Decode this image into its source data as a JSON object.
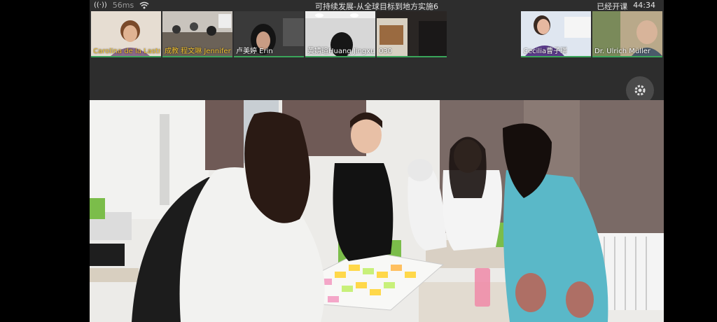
{
  "status_bar": {
    "network_latency": "56ms",
    "meeting_title": "可持续发展-从全球目标到地方实施6",
    "class_status": "已经开课",
    "time": "44:34"
  },
  "participants": [
    {
      "name": "Carolina de la Lastra",
      "name_color": "#f0c030"
    },
    {
      "name": "成教 程文琳 Jennifer",
      "name_color": "#f0c030"
    },
    {
      "name": "卢美婷 Erin",
      "name_color": "#ffffff"
    },
    {
      "name": "黄婧瑄Huang Jingxu",
      "name_color": "#ffffff"
    },
    {
      "name": "030",
      "name_color": "#ffffff"
    },
    {
      "name": "Cecilia曹子琪",
      "name_color": "#ffffff"
    },
    {
      "name": "Dr. Ulrich Müller",
      "name_color": "#ffffff"
    }
  ],
  "side_toolbar": [
    {
      "icon": "gear-icon"
    },
    {
      "icon": "chat-icon"
    },
    {
      "icon": "participants-icon"
    },
    {
      "icon": "raise-hand-icon"
    }
  ]
}
